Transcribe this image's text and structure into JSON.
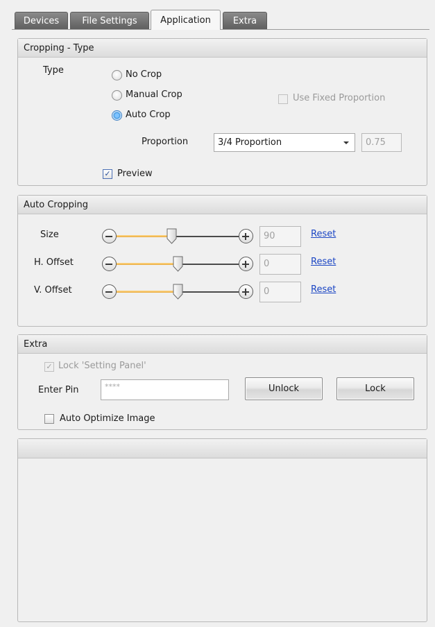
{
  "tabs": [
    {
      "label": "Devices"
    },
    {
      "label": "File Settings"
    },
    {
      "label": "Application"
    },
    {
      "label": "Extra"
    }
  ],
  "cropping_type": {
    "header": "Cropping - Type",
    "type_label": "Type",
    "options": [
      {
        "label": "No Crop",
        "selected": false
      },
      {
        "label": "Manual Crop",
        "selected": false
      },
      {
        "label": "Auto Crop",
        "selected": true
      }
    ],
    "use_fixed_proportion": {
      "label": "Use Fixed Proportion",
      "checked": false,
      "enabled": false
    },
    "proportion_label": "Proportion",
    "proportion_value": "3/4 Proportion",
    "proportion_ratio": "0.75",
    "preview": {
      "label": "Preview",
      "checked": true
    }
  },
  "auto_cropping": {
    "header": "Auto Cropping",
    "sliders": [
      {
        "label": "Size",
        "value": "90",
        "level": 0.45,
        "reset_label": "Reset"
      },
      {
        "label": "H. Offset",
        "value": "0",
        "level": 0.5,
        "reset_label": "Reset"
      },
      {
        "label": "V. Offset",
        "value": "0",
        "level": 0.5,
        "reset_label": "Reset"
      }
    ]
  },
  "extra": {
    "header": "Extra",
    "lock_setting_panel": {
      "label": "Lock 'Setting Panel'",
      "checked": true,
      "enabled": false
    },
    "enter_pin_label": "Enter Pin",
    "pin_value": "****",
    "unlock_label": "Unlock",
    "lock_label": "Lock",
    "auto_optimize": {
      "label": "Auto Optimize Image",
      "checked": false
    }
  },
  "empty_panel": {
    "header": ""
  },
  "colors": {
    "accent_blue": "#3e95df",
    "link": "#1b46c4",
    "slider_fill": "#e8a93a"
  }
}
